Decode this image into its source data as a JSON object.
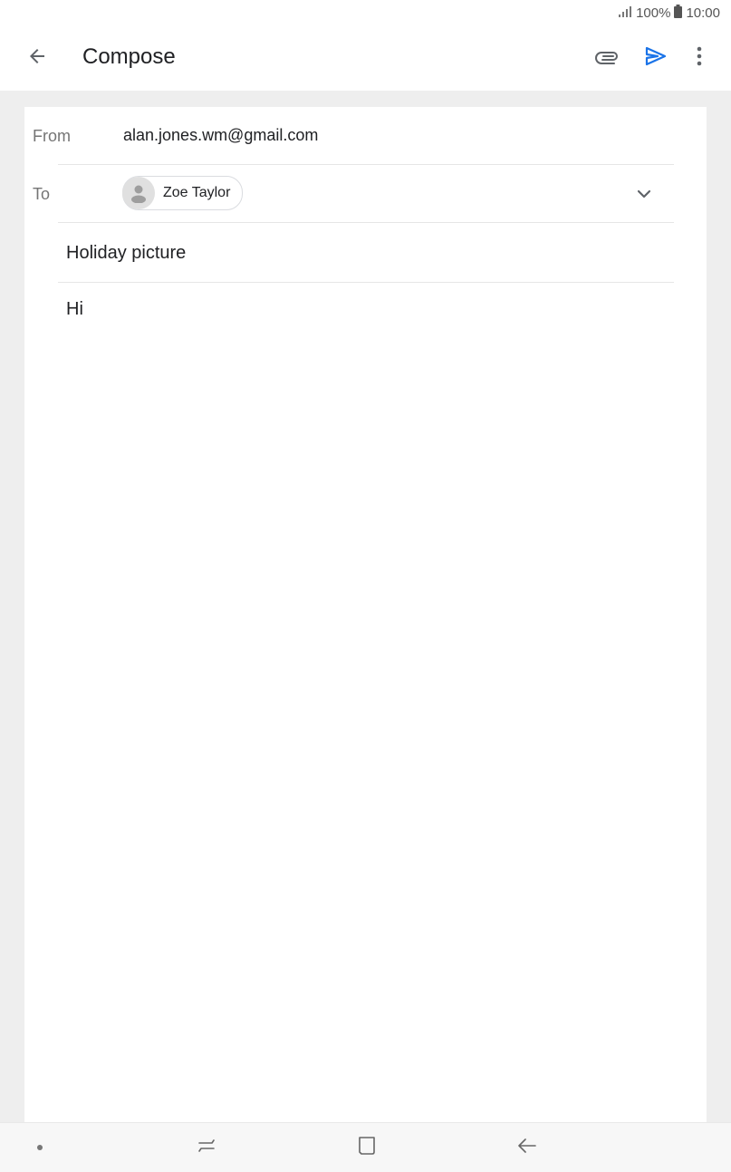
{
  "status_bar": {
    "signal_icon": "signal-bars-icon",
    "battery_text": "100%",
    "battery_icon": "battery-full-icon",
    "time": "10:00"
  },
  "app_bar": {
    "title": "Compose",
    "back_icon": "arrow-back-icon",
    "attach_icon": "paperclip-icon",
    "send_icon": "send-icon",
    "more_icon": "more-vertical-icon",
    "send_color": "#1a73e8"
  },
  "compose": {
    "from_label": "From",
    "from_value": "alan.jones.wm@gmail.com",
    "to_label": "To",
    "recipient": {
      "name": "Zoe Taylor",
      "avatar_icon": "person-avatar-icon"
    },
    "expand_icon": "chevron-down-icon",
    "subject": "Holiday picture",
    "body": "Hi"
  },
  "nav_bar": {
    "items": [
      "dot-indicator-icon",
      "recents-icon",
      "home-icon",
      "back-icon"
    ]
  }
}
